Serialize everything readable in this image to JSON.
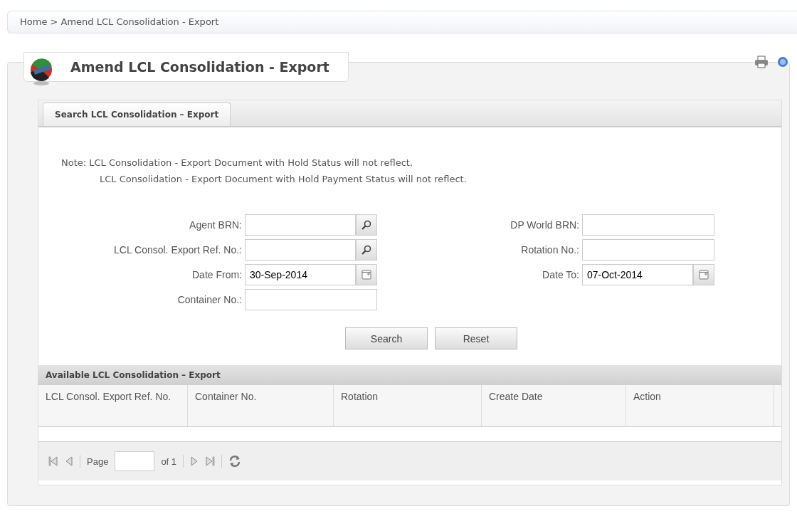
{
  "breadcrumb": "Home > Amend LCL Consolidation - Export",
  "page_title": "Amend LCL Consolidation - Export",
  "tabs": [
    {
      "label": "Search LCL Consolidation – Export",
      "selected": true
    }
  ],
  "note": [
    "Note: LCL Consolidation - Export Document with Hold Status will not reflect.",
    "LCL Consolidation - Export Document with Hold Payment Status will not reflect."
  ],
  "form_left": [
    {
      "label": "Agent BRN:",
      "kind": "lookup"
    },
    {
      "label": "LCL Consol. Export Ref. No.:",
      "kind": "lookup"
    },
    {
      "label": "Date From:",
      "kind": "date",
      "value": "30-Sep-2014"
    },
    {
      "label": "Container No.:",
      "kind": "text"
    }
  ],
  "form_right": [
    {
      "label": "DP World BRN:",
      "kind": "text"
    },
    {
      "label": "Rotation No.:",
      "kind": "text"
    },
    {
      "label": "Date To:",
      "kind": "date",
      "value": "07-Oct-2014"
    }
  ],
  "buttons": [
    "Search",
    "Reset"
  ],
  "results": {
    "title": "Available LCL Consolidation – Export",
    "columns": [
      "LCL Consol. Export Ref. No.",
      "Container No.",
      "Rotation",
      "Create Date",
      "Action"
    ],
    "pager": {
      "page_label": "Page",
      "of_label": "of 1"
    }
  }
}
